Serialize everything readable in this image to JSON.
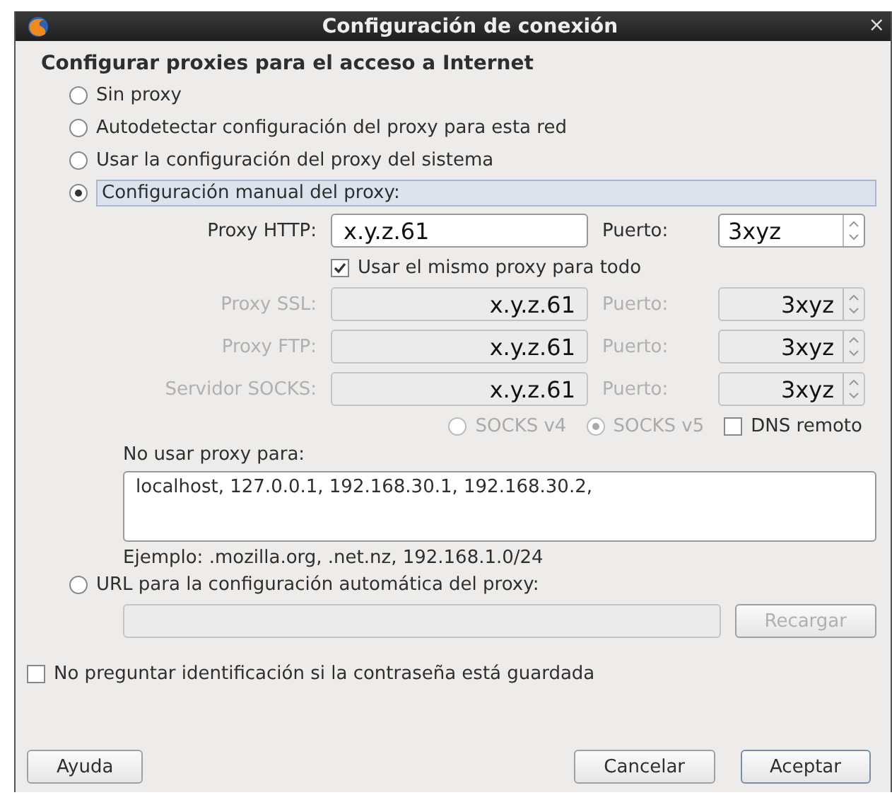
{
  "window": {
    "title": "Configuración de conexión",
    "close": "×"
  },
  "heading": "Configurar proxies para el acceso a Internet",
  "proxy_modes": [
    {
      "kind": "plain",
      "label": "Sin proxy",
      "selected": false
    },
    {
      "kind": "plain",
      "label": "Autodetectar configuración del proxy para esta red",
      "selected": false
    },
    {
      "kind": "plain",
      "label": "Usar la configuración del proxy del sistema",
      "selected": false
    },
    {
      "kind": "manual",
      "label": "Configuración manual del proxy:",
      "selected": true
    },
    {
      "kind": "auto",
      "label": "URL para la configuración automática del proxy:",
      "selected": false
    }
  ],
  "manual": {
    "rows": [
      {
        "label": "Proxy HTTP:",
        "host": "x.y.z.61",
        "port_label": "Puerto:",
        "port": "3xyz",
        "disabled": false
      },
      {
        "label": "Proxy SSL:",
        "host": "x.y.z.61",
        "port_label": "Puerto:",
        "port": "3xyz",
        "disabled": true
      },
      {
        "label": "Proxy FTP:",
        "host": "x.y.z.61",
        "port_label": "Puerto:",
        "port": "3xyz",
        "disabled": true
      },
      {
        "label": "Servidor SOCKS:",
        "host": "x.y.z.61",
        "port_label": "Puerto:",
        "port": "3xyz",
        "disabled": true
      }
    ],
    "same_for_all": {
      "label": "Usar el mismo proxy para todo",
      "checked": true
    },
    "socks_versions": [
      {
        "label": "SOCKS v4",
        "selected": false
      },
      {
        "label": "SOCKS v5",
        "selected": true
      }
    ],
    "remote_dns": {
      "label": "DNS remoto",
      "checked": false
    },
    "no_proxy": {
      "label": "No usar proxy para:",
      "value": "localhost, 127.0.0.1, 192.168.30.1, 192.168.30.2,"
    },
    "example": "Ejemplo: .mozilla.org, .net.nz, 192.168.1.0/24"
  },
  "auto": {
    "reload": "Recargar",
    "disabled": true
  },
  "no_prompt": {
    "label": "No preguntar identificación si la contraseña está guardada",
    "checked": false
  },
  "buttons": {
    "help": "Ayuda",
    "cancel": "Cancelar",
    "ok": "Aceptar"
  }
}
